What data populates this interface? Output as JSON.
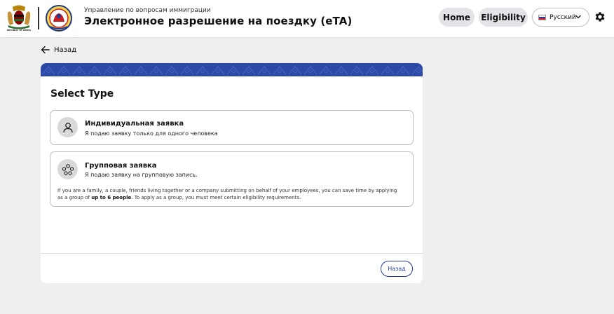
{
  "header": {
    "seal_caption": "REPUBLIC OF KENYA",
    "subtitle": "Управление по вопросам иммиграции",
    "title": "Электронное разрешение на поездку (eTA)",
    "nav": {
      "home_label": "Home",
      "eligibility_label": "Eligibility"
    },
    "language": {
      "selected": "Русский",
      "flag": "russia-flag"
    },
    "settings_icon": "gear-icon"
  },
  "back_link": {
    "label": "Назад",
    "icon": "arrow-left-icon"
  },
  "card": {
    "banner_color": "#2c49a8",
    "title": "Select Type",
    "options": [
      {
        "icon": "person-icon",
        "title": "Индивидуальная заявка",
        "description": "Я подаю заявку только для одного человека"
      },
      {
        "icon": "group-icon",
        "title": "Групповая заявка",
        "description": "Я подаю заявку на групповую запись.",
        "note_part1": "If you are a family, a couple, friends living together or a company submitting on behalf of your employees, you can save time by applying as a group of ",
        "note_bold": "up to 6 people",
        "note_part2": ". To apply as a group, you must meet certain eligibility requirements."
      }
    ],
    "footer": {
      "back_button_label": "Назад"
    }
  },
  "colors": {
    "accent": "#1f3a93",
    "page_background": "#efefef",
    "pill_background": "#e3e4e8"
  }
}
